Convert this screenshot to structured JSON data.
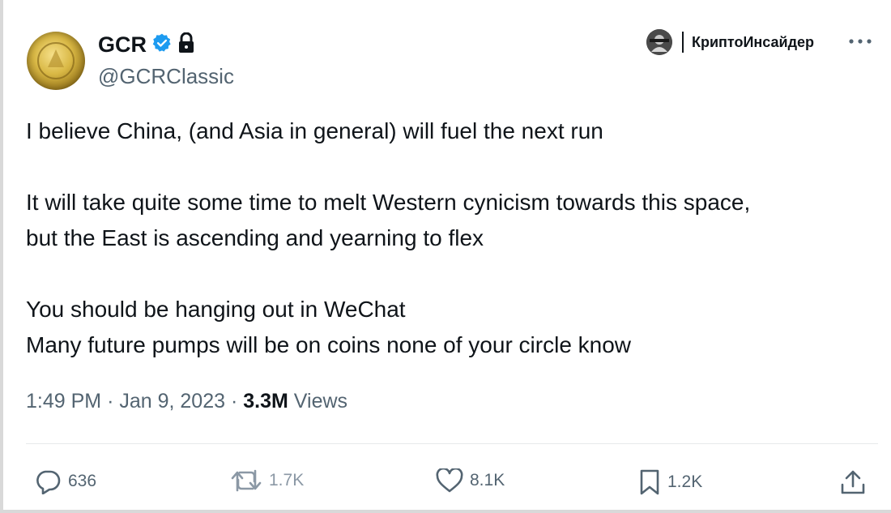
{
  "author": {
    "name": "GCR",
    "handle": "@GCRClassic",
    "verified_icon": "verified-badge-icon",
    "lock_icon": "lock-icon"
  },
  "channel": {
    "name": "КриптоИнсайдер"
  },
  "tweet": {
    "lines": [
      "I believe China, (and Asia in general) will fuel the next run",
      "It will take quite some time to melt Western cynicism towards this space,",
      "but the East is ascending and yearning to flex",
      "You should be hanging out in WeChat",
      "Many future pumps will be on coins none of your circle know"
    ]
  },
  "meta": {
    "time": "1:49 PM",
    "separator": "·",
    "date": "Jan 9, 2023",
    "views_count": "3.3M",
    "views_label": "Views"
  },
  "actions": {
    "replies": "636",
    "reposts": "1.7K",
    "likes": "8.1K",
    "bookmarks": "1.2K"
  },
  "colors": {
    "text": "#0f1419",
    "secondary": "#536471",
    "verified": "#1d9bf0",
    "divider": "#e7e9ea"
  }
}
